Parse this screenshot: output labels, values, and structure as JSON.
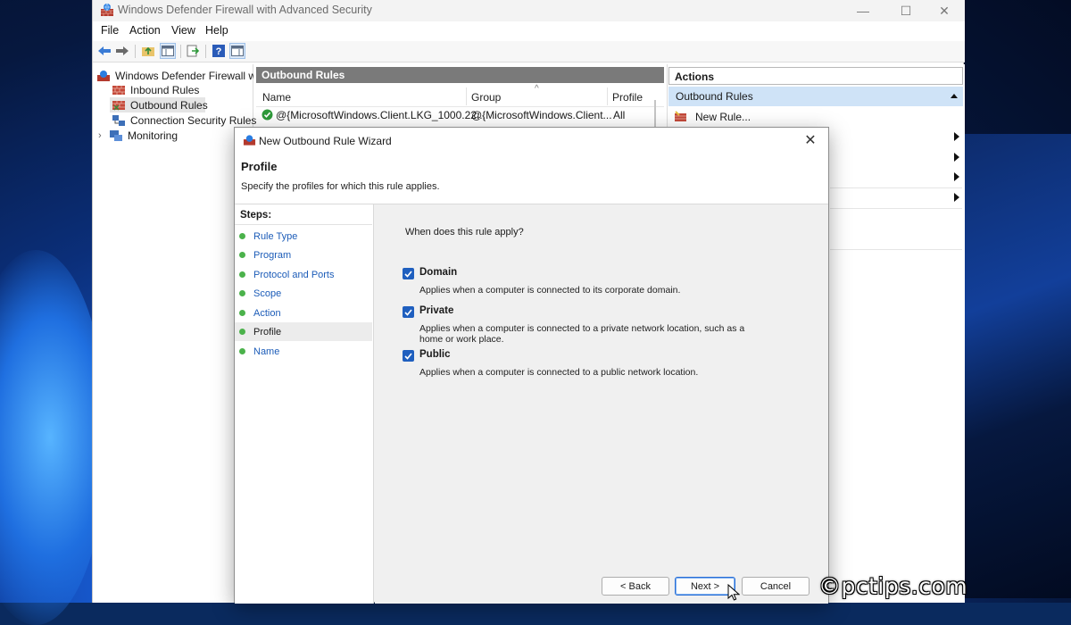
{
  "window": {
    "title": "Windows Defender Firewall with Advanced Security",
    "controls": {
      "minimize": "—",
      "maximize": "☐",
      "close": "✕"
    }
  },
  "menu": {
    "items": [
      "File",
      "Action",
      "View",
      "Help"
    ]
  },
  "toolbar": {
    "icons": [
      "back-arrow-icon",
      "forward-arrow-icon",
      "folder-up-icon",
      "show-hide-tree-icon",
      "export-list-icon",
      "help-icon",
      "properties-icon"
    ]
  },
  "tree": {
    "root": "Windows Defender Firewall witl",
    "items": [
      {
        "label": "Inbound Rules",
        "icon": "inbound-rules-icon"
      },
      {
        "label": "Outbound Rules",
        "icon": "outbound-rules-icon",
        "selected": true
      },
      {
        "label": "Connection Security Rules",
        "icon": "connection-security-icon"
      },
      {
        "label": "Monitoring",
        "icon": "monitoring-icon"
      }
    ]
  },
  "center": {
    "header": "Outbound Rules",
    "columns": [
      "Name",
      "Group",
      "Profile"
    ],
    "rows": [
      {
        "name": "@{MicrosoftWindows.Client.LKG_1000.22...",
        "group": "@{MicrosoftWindows.Client...",
        "profile": "All"
      }
    ]
  },
  "actions": {
    "header": "Actions",
    "section": "Outbound Rules",
    "items": [
      {
        "label": "New Rule..."
      }
    ]
  },
  "dialog": {
    "title": "New Outbound Rule Wizard",
    "heading": "Profile",
    "subtitle": "Specify the profiles for which this rule applies.",
    "steps_label": "Steps:",
    "steps": [
      "Rule Type",
      "Program",
      "Protocol and Ports",
      "Scope",
      "Action",
      "Profile",
      "Name"
    ],
    "current_step": "Profile",
    "question": "When does this rule apply?",
    "options": [
      {
        "label": "Domain",
        "checked": true,
        "description": "Applies when a computer is connected to its corporate domain."
      },
      {
        "label": "Private",
        "checked": true,
        "description": "Applies when a computer is connected to a private network location, such as a home or work place."
      },
      {
        "label": "Public",
        "checked": true,
        "description": "Applies when a computer is connected to a public network location."
      }
    ],
    "buttons": {
      "back": "< Back",
      "next": "Next >",
      "cancel": "Cancel"
    },
    "close": "✕"
  },
  "watermark": "©pctips.com",
  "colors": {
    "accent": "#1f5fbf",
    "selection": "#cfe3f7",
    "step_dot": "#4bb24b",
    "link": "#1c5cb8"
  }
}
